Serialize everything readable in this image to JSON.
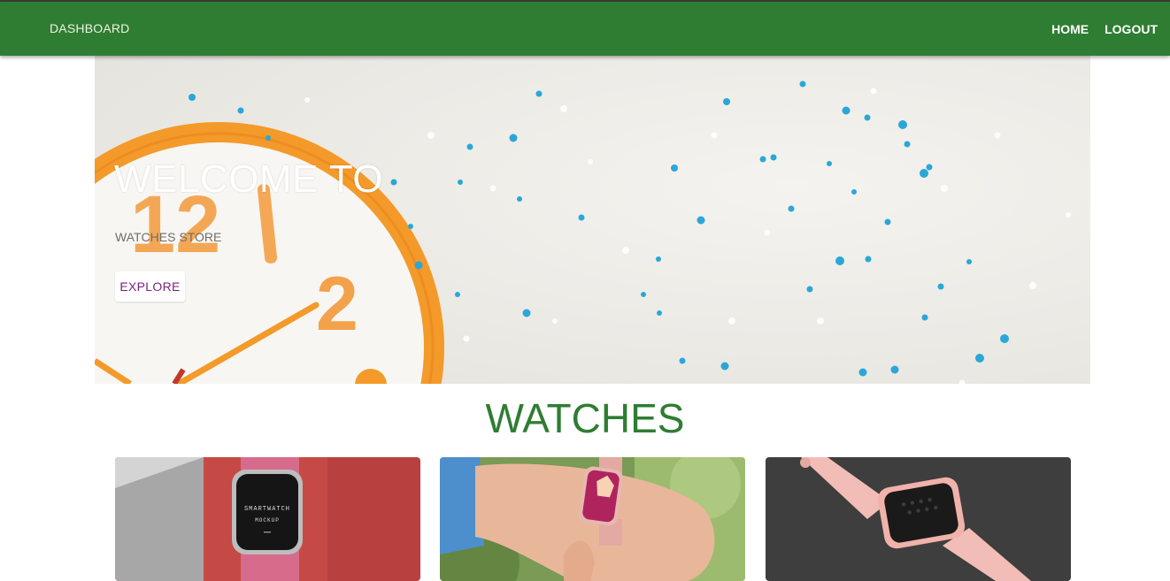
{
  "navbar": {
    "brand": "DASHBOARD",
    "links": [
      {
        "label": "HOME"
      },
      {
        "label": "LOGOUT"
      }
    ]
  },
  "hero": {
    "title": "WELCOME TO",
    "subtitle": "WATCHES STORE",
    "button_label": "EXPLORE"
  },
  "section": {
    "title": "WATCHES"
  },
  "products": [
    {
      "screen_text_1": "SMARTWATCH",
      "screen_text_2": "MOCKUP"
    },
    {},
    {}
  ],
  "colors": {
    "navbar": "#2e7d32",
    "section_title": "#2e7d32",
    "explore_text": "#7b1f7b"
  }
}
